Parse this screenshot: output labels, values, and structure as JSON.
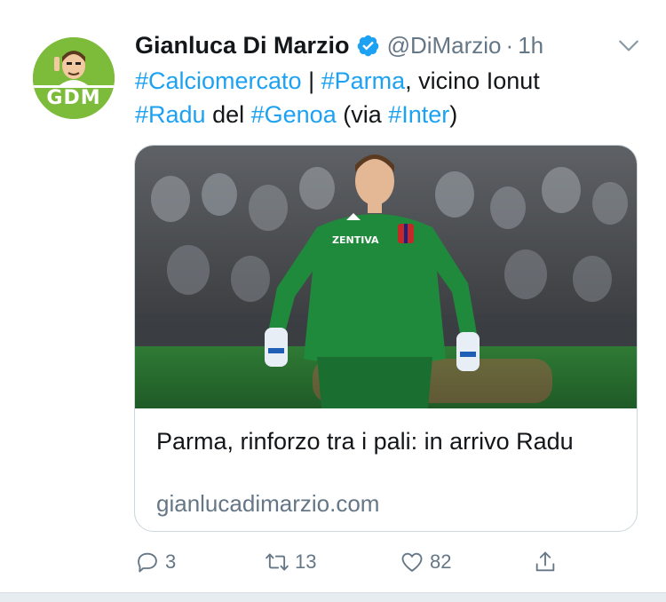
{
  "author": {
    "name": "Gianluca Di Marzio",
    "handle": "@DiMarzio",
    "separator": "·",
    "time": "1h",
    "avatar_text": "GDM",
    "verified": true
  },
  "tweet": {
    "segments": [
      {
        "text": "#Calciomercato",
        "type": "hashtag"
      },
      {
        "text": " | ",
        "type": "text"
      },
      {
        "text": "#Parma",
        "type": "hashtag"
      },
      {
        "text": ", vicino Ionut ",
        "type": "text"
      },
      {
        "text": "#Radu",
        "type": "hashtag"
      },
      {
        "text": " del ",
        "type": "text"
      },
      {
        "text": "#Genoa",
        "type": "hashtag"
      },
      {
        "text": " (via ",
        "type": "text"
      },
      {
        "text": "#Inter",
        "type": "hashtag"
      },
      {
        "text": ")",
        "type": "text"
      }
    ]
  },
  "card": {
    "title": "Parma, rinforzo tra i pali: in arrivo Radu",
    "domain": "gianlucadimarzio.com",
    "jersey_sponsor": "ZENTIVA"
  },
  "actions": {
    "replies": "3",
    "retweets": "13",
    "likes": "82"
  },
  "colors": {
    "link": "#1da1f2",
    "secondary_text": "#657786",
    "avatar_bg": "#7dbb3a",
    "jersey": "#1f8a3c"
  },
  "icons": [
    "verified-badge-icon",
    "chevron-down-icon",
    "reply-icon",
    "retweet-icon",
    "like-icon",
    "share-icon"
  ]
}
